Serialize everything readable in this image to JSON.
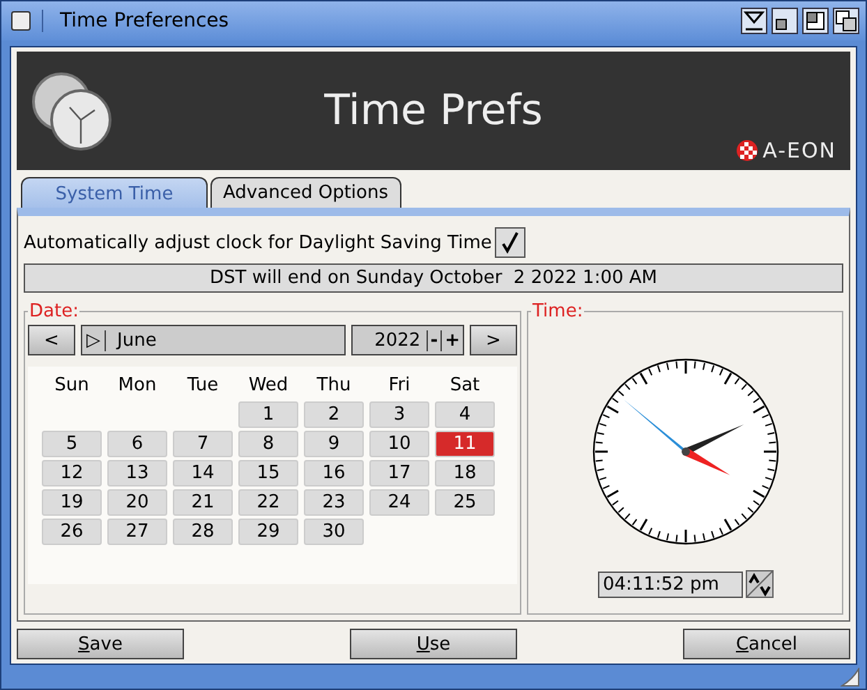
{
  "window": {
    "title": "Time Preferences"
  },
  "banner": {
    "title": "Time Prefs",
    "brand": "A-EON"
  },
  "tabs": [
    {
      "label": "System Time",
      "selected": true
    },
    {
      "label": "Advanced Options",
      "selected": false
    }
  ],
  "dst": {
    "label": "Automatically adjust clock for Daylight Saving Time",
    "checked": true,
    "status": "DST will end on Sunday October  2 2022 1:00 AM"
  },
  "date": {
    "legend": "Date:",
    "prev": "<",
    "next": ">",
    "month_toggle": "▷",
    "month": "June",
    "year": "2022",
    "minus": "-",
    "plus": "+",
    "weekdays": [
      "Sun",
      "Mon",
      "Tue",
      "Wed",
      "Thu",
      "Fri",
      "Sat"
    ],
    "weeks": [
      [
        {
          "kind": "blank"
        },
        {
          "kind": "blank"
        },
        {
          "kind": "blank"
        },
        {
          "day": "1",
          "selected": false
        },
        {
          "day": "2",
          "selected": false
        },
        {
          "day": "3",
          "selected": false
        },
        {
          "day": "4",
          "selected": false
        }
      ],
      [
        {
          "day": "5",
          "selected": false
        },
        {
          "day": "6",
          "selected": false
        },
        {
          "day": "7",
          "selected": false
        },
        {
          "day": "8",
          "selected": false
        },
        {
          "day": "9",
          "selected": false
        },
        {
          "day": "10",
          "selected": false
        },
        {
          "day": "11",
          "selected": true
        }
      ],
      [
        {
          "day": "12",
          "selected": false
        },
        {
          "day": "13",
          "selected": false
        },
        {
          "day": "14",
          "selected": false
        },
        {
          "day": "15",
          "selected": false
        },
        {
          "day": "16",
          "selected": false
        },
        {
          "day": "17",
          "selected": false
        },
        {
          "day": "18",
          "selected": false
        }
      ],
      [
        {
          "day": "19",
          "selected": false
        },
        {
          "day": "20",
          "selected": false
        },
        {
          "day": "21",
          "selected": false
        },
        {
          "day": "22",
          "selected": false
        },
        {
          "day": "23",
          "selected": false
        },
        {
          "day": "24",
          "selected": false
        },
        {
          "day": "25",
          "selected": false
        }
      ],
      [
        {
          "day": "26",
          "selected": false
        },
        {
          "day": "27",
          "selected": false
        },
        {
          "day": "28",
          "selected": false
        },
        {
          "day": "29",
          "selected": false
        },
        {
          "day": "30",
          "selected": false
        },
        {
          "kind": "blank"
        },
        {
          "kind": "blank"
        }
      ]
    ]
  },
  "time": {
    "legend": "Time:",
    "value": "04:11:52 pm"
  },
  "buttons": [
    {
      "label": "Save",
      "first_letter_underlined": true
    },
    {
      "label": "Use",
      "first_letter_underlined": true
    },
    {
      "label": "Cancel",
      "first_letter_underlined": true
    }
  ]
}
